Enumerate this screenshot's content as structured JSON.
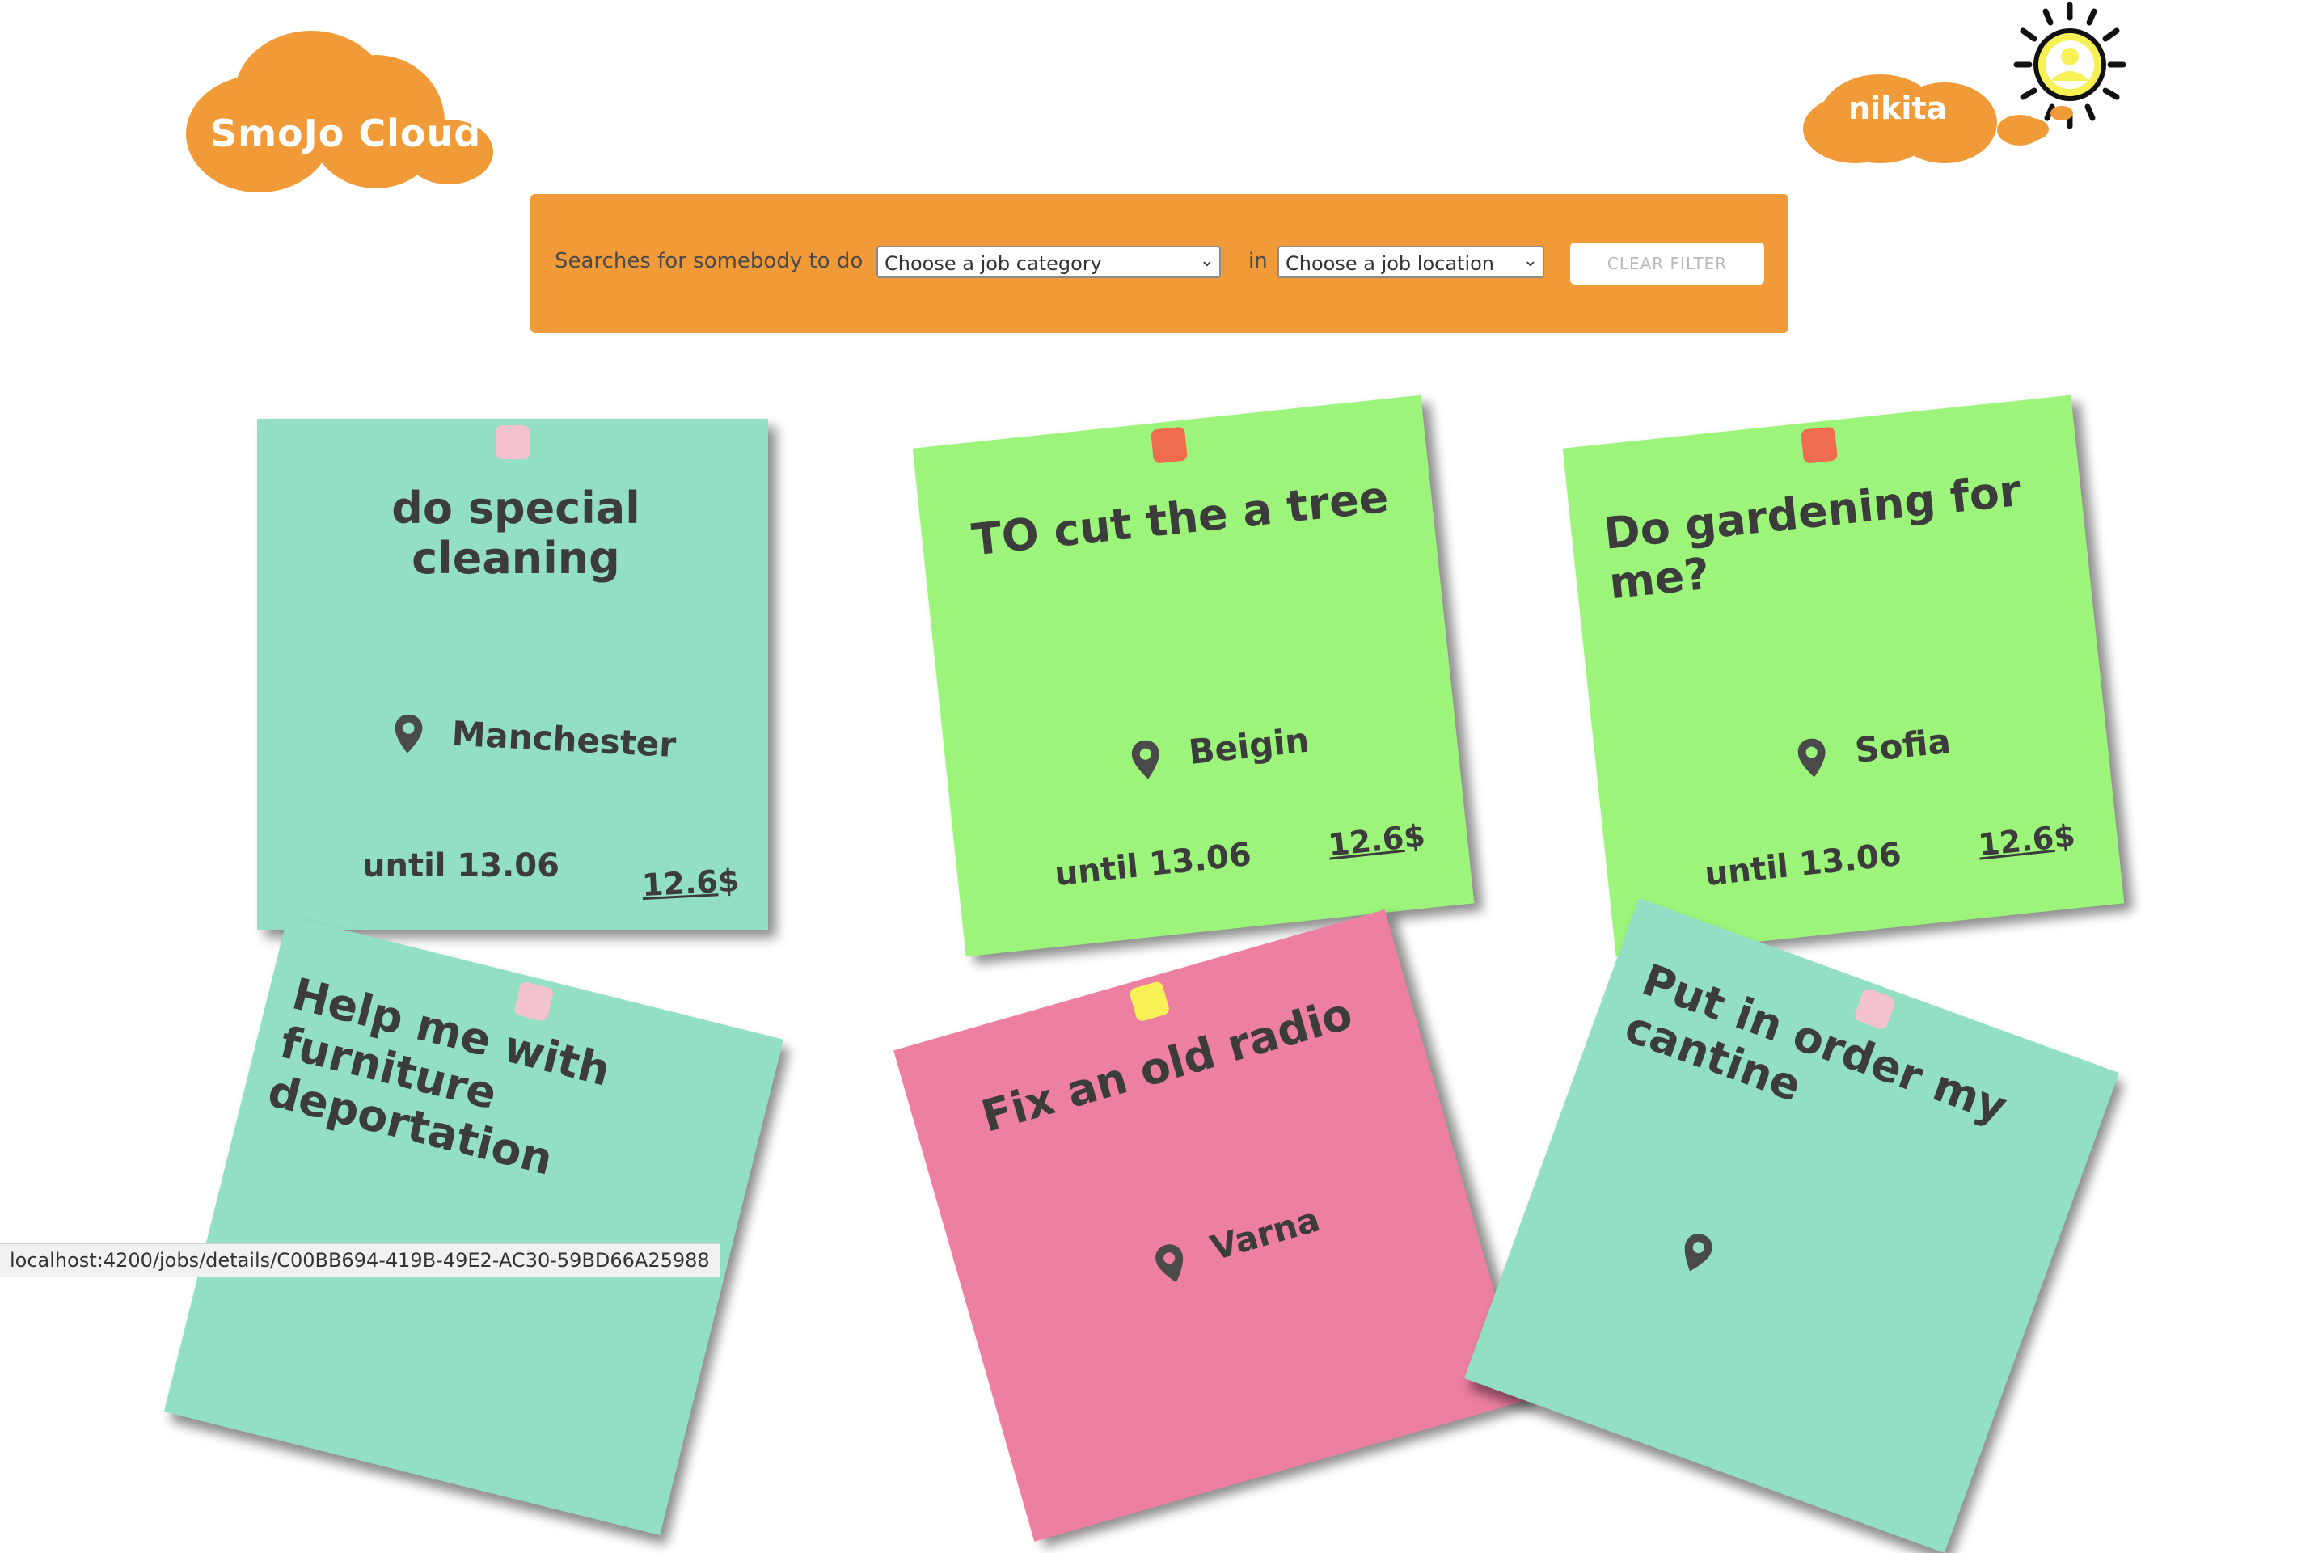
{
  "header": {
    "logo_text": "SmoJo Cloud",
    "user_name": "nikita"
  },
  "filter": {
    "prefix_label": "Searches for somebody to do",
    "category_select": "Choose a job category",
    "in_label": "in",
    "location_select": "Choose a job location",
    "clear_button": "CLEAR FILTER"
  },
  "jobs": [
    {
      "title": "do special cleaning",
      "location": "Manchester",
      "until": "until 13.06",
      "price": "12.6",
      "currency": "$",
      "color": "#93dfc5",
      "pin_color": "#f4c2cc"
    },
    {
      "title": "TO cut the a tree",
      "location": "Beigin",
      "until": "until 13.06",
      "price": "12.6",
      "currency": "$",
      "color": "#9cf57a",
      "pin_color": "#ef6c4f"
    },
    {
      "title": "Do gardening for me?",
      "location": "Sofia",
      "until": "until 13.06",
      "price": "12.6",
      "currency": "$",
      "color": "#9cf57a",
      "pin_color": "#ef6c4f"
    },
    {
      "title": "Help me with furniture deportation",
      "location": "",
      "until": "",
      "price": "",
      "currency": "",
      "color": "#93dfc5",
      "pin_color": "#f4c2cc"
    },
    {
      "title": "Fix an old radio",
      "location": "Varna",
      "until": "",
      "price": "",
      "currency": "",
      "color": "#ed7fa0",
      "pin_color": "#f7f155"
    },
    {
      "title": "Put in order my cantine",
      "location": "",
      "until": "",
      "price": "",
      "currency": "",
      "color": "#93dfc5",
      "pin_color": "#f4c2cc"
    }
  ],
  "status_bar": {
    "url": "localhost:4200/jobs/details/C00BB694-419B-49E2-AC30-59BD66A25988"
  },
  "colors": {
    "accent_orange": "#f19a38",
    "note_teal": "#93dfc5",
    "note_green": "#9cf57a",
    "note_pink": "#ed7fa0"
  },
  "icons": [
    "map-pin-icon",
    "chevron-down-icon",
    "sun-avatar-icon",
    "user-icon"
  ]
}
